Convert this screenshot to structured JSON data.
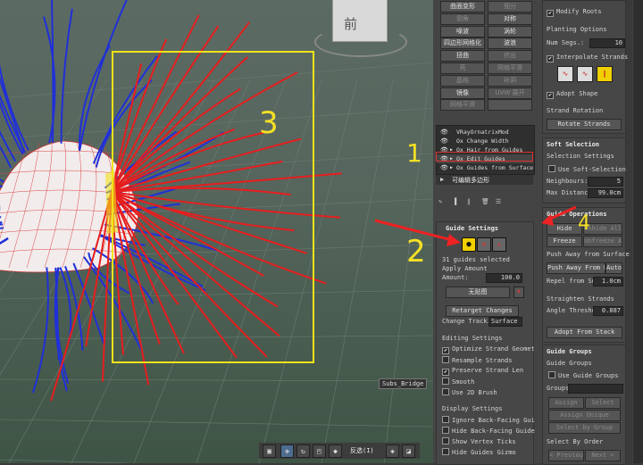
{
  "viewport": {
    "label": "Subs_Bridge",
    "viewcube_label": "前",
    "bottom_toolbar": {
      "selection_label": "反选(I)"
    }
  },
  "annotations": {
    "n1": "1",
    "n2": "2",
    "n3": "3",
    "n4": "4"
  },
  "modifier_buttons": [
    {
      "label": "曲面变形",
      "dim": false
    },
    {
      "label": "细分",
      "dim": true
    },
    {
      "label": "倒角",
      "dim": true
    },
    {
      "label": "对称",
      "dim": false
    },
    {
      "label": "噪波",
      "dim": false
    },
    {
      "label": "涡轮",
      "dim": false
    },
    {
      "label": "四边形网格化",
      "dim": false
    },
    {
      "label": "波浪",
      "dim": false
    },
    {
      "label": "扭曲",
      "dim": false
    },
    {
      "label": "挤出",
      "dim": true
    },
    {
      "label": "壳",
      "dim": true
    },
    {
      "label": "网格平滑",
      "dim": true
    },
    {
      "label": "晶格",
      "dim": true
    },
    {
      "label": "补洞",
      "dim": true
    },
    {
      "label": "镜像",
      "dim": false
    },
    {
      "label": "UVW 展开",
      "dim": true
    },
    {
      "label": "网格平滑",
      "dim": true
    },
    {
      "label": "",
      "dim": true
    }
  ],
  "modifier_stack": {
    "items": [
      "VRayOrnatrixMod",
      "Ox Change Width",
      "Ox Hair from Guides",
      "Ox Edit Guides",
      "Ox Guides from Surface"
    ],
    "base": "可编辑多边形"
  },
  "guide_settings": {
    "title": "Guide Settings",
    "selected": "31 guides selected",
    "apply_amount_label": "Apply Amount",
    "amount_label": "Amount:",
    "amount_value": "100.0",
    "none_button": "无贴图",
    "retarget": "Retarget Changes",
    "change_tracking_label": "Change Trackin",
    "change_tracking_value": "Surface",
    "editing_settings_label": "Editing Settings",
    "optimize": "Optimize Strand Geomet",
    "resample": "Resample Strands",
    "preserve": "Preserve Strand Len",
    "smooth": "Smooth",
    "use2d": "Use 2D Brush",
    "display_settings_label": "Display Settings",
    "ignore_back": "Ignore Back-Facing Gui",
    "hide_back": "Hide Back-Facing Guide",
    "show_vertex": "Show Vertex Ticks",
    "hide_gizmo": "Hide Guides Gizmo"
  },
  "right_panel": {
    "modify_roots": "Modify Roots",
    "planting_options": "Planting Options",
    "num_segs_label": "Num Segs.:",
    "num_segs_value": "10",
    "interpolate": "Interpolate Strands",
    "adopt_shape": "Adopt Shape",
    "strand_rotation": "Strand Rotation",
    "rotate_strands": "Rotate Strands",
    "soft_selection": "Soft Selection",
    "selection_settings": "Selection Settings",
    "use_soft": "Use Soft-Selection",
    "neighbours_label": "Neighbours:",
    "neighbours_value": "5",
    "max_distance_label": "Max Distanc",
    "max_distance_value": "99.0cm",
    "guide_operations": "Guide Operations",
    "hide": "Hide",
    "unhide_all": "Unhide All",
    "freeze": "Freeze",
    "unfreeze_all": "Unfreeze All",
    "push_away_surface": "Push Away from Surface",
    "push_away_mesh": "Push Away From Mesh",
    "auto": "Auto",
    "repel_label": "Repel from Sur:",
    "repel_value": "1.0cm",
    "straighten": "Straighten Strands",
    "angle_label": "Angle Threshol:",
    "angle_value": "0.887",
    "adopt_stack": "Adopt From Stack",
    "guide_groups": "Guide Groups",
    "guide_groups_sub": "Guide Groups",
    "use_guide_groups": "Use Guide Groups",
    "groups_label": "Groups:",
    "assign": "Assign",
    "select": "Select",
    "assign_unique": "Assign Unique",
    "select_by_group": "Select by Group",
    "select_by_order": "Select By Order",
    "previous": "< Previous",
    "next": "Next >"
  }
}
